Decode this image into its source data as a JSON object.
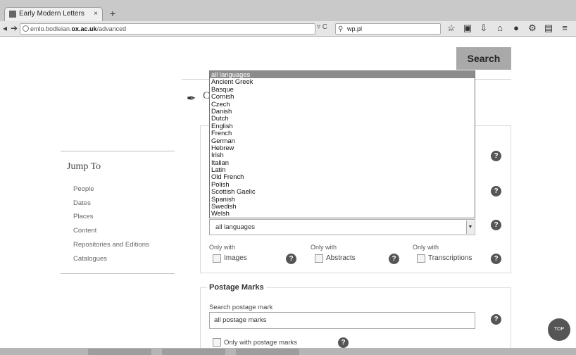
{
  "browser": {
    "tab_title": "Early Modern Letters Onlin...",
    "tab_close": "×",
    "new_tab": "+",
    "url_host": "emlo.bodleian.",
    "url_domain": "ox.ac.uk",
    "url_path": "/advanced",
    "url_controls": "▿ C",
    "search_text": "wp.pl",
    "search_go": "→",
    "toolbar_icons": [
      "star-icon",
      "clipboard-icon",
      "download-icon",
      "home-icon",
      "chat-icon",
      "puzzle-icon",
      "document-icon",
      "menu-icon"
    ]
  },
  "page": {
    "search_button": "Search",
    "heading_partial": "C",
    "jump_to": {
      "title": "Jump To",
      "items": [
        "People",
        "Dates",
        "Places",
        "Content",
        "Repositories and Editions",
        "Catalogues"
      ]
    },
    "language_select": {
      "selected": "all languages",
      "options": [
        "all languages",
        "Ancient Greek",
        "Basque",
        "Cornish",
        "Czech",
        "Danish",
        "Dutch",
        "English",
        "French",
        "German",
        "Hebrew",
        "Irish",
        "Italian",
        "Latin",
        "Old French",
        "Polish",
        "Scottish Gaelic",
        "Spanish",
        "Swedish",
        "Welsh"
      ]
    },
    "only_with": {
      "label": "Only with",
      "images": "Images",
      "abstracts": "Abstracts",
      "transcriptions": "Transcriptions"
    },
    "help_glyph": "?",
    "postage": {
      "legend": "Postage Marks",
      "search_label": "Search postage mark",
      "input_value": "all postage marks",
      "only_with_label": "Only with postage marks"
    },
    "top_button": "TOP"
  },
  "colors": {
    "search_button_bg": "#a9a9a9",
    "selected_option_bg": "#8c8c8c",
    "help_icon_bg": "#555555"
  }
}
